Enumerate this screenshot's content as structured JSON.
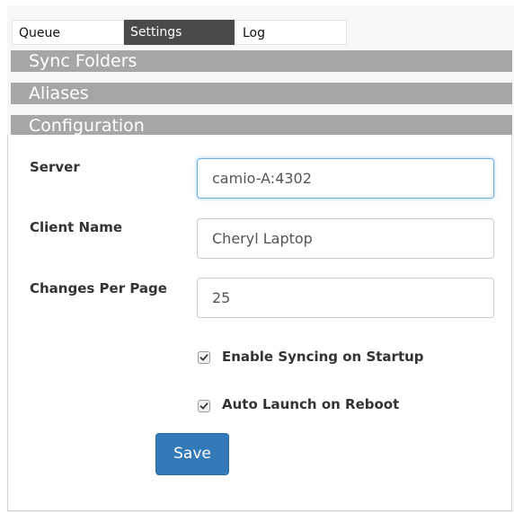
{
  "tabs": [
    {
      "label": "Queue"
    },
    {
      "label": "Settings"
    },
    {
      "label": "Log"
    }
  ],
  "sections": {
    "sync_folders": "Sync Folders",
    "aliases": "Aliases",
    "configuration": "Configuration"
  },
  "form": {
    "server": {
      "label": "Server",
      "value": "camio-A:4302"
    },
    "client_name": {
      "label": "Client Name",
      "value": "Cheryl Laptop"
    },
    "changes_per_page": {
      "label": "Changes Per Page",
      "value": "25"
    },
    "enable_syncing": {
      "label": "Enable Syncing on Startup",
      "checked": true
    },
    "auto_launch": {
      "label": "Auto Launch on Reboot",
      "checked": true
    },
    "save_label": "Save"
  },
  "colors": {
    "active_tab": "#4a4a4a",
    "section_bar": "#a6a6a6",
    "primary_button": "#337ab7",
    "focus_border": "#66afe9"
  },
  "icons": {
    "checkbox_checked": "checkmark-icon"
  }
}
